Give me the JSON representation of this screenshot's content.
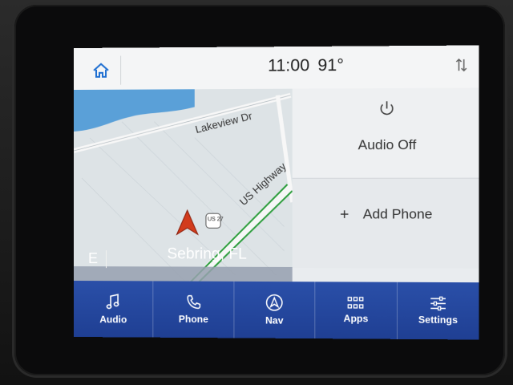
{
  "status": {
    "time": "11:00",
    "temperature": "91°"
  },
  "map": {
    "roads": [
      "Lakeview Dr",
      "US Highway"
    ],
    "route_shield": "US 27",
    "compass": "E",
    "city": "Sebring, FL"
  },
  "panels": {
    "audio": "Audio Off",
    "phone_prefix": "+",
    "phone": "Add Phone"
  },
  "navbar": {
    "items": [
      {
        "label": "Audio",
        "icon": "music-note-icon"
      },
      {
        "label": "Phone",
        "icon": "phone-handset-icon"
      },
      {
        "label": "Nav",
        "icon": "navigation-arrow-icon"
      },
      {
        "label": "Apps",
        "icon": "apps-grid-icon"
      },
      {
        "label": "Settings",
        "icon": "sliders-icon"
      }
    ]
  },
  "colors": {
    "navbar": "#2a4fa8",
    "accent": "#1f6fd1",
    "route": "#2e9e3e",
    "vehicle": "#d23b1c",
    "water": "#5aa0d8"
  }
}
